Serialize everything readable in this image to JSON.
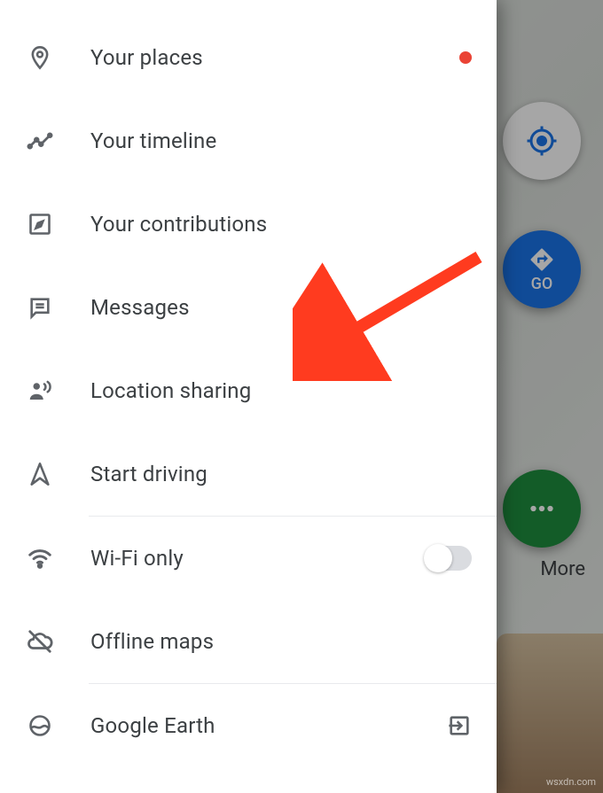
{
  "menu": {
    "items": [
      {
        "id": "your-places",
        "label": "Your places",
        "has_badge": true
      },
      {
        "id": "your-timeline",
        "label": "Your timeline"
      },
      {
        "id": "your-contributions",
        "label": "Your contributions"
      },
      {
        "id": "messages",
        "label": "Messages"
      },
      {
        "id": "location-sharing",
        "label": "Location sharing"
      },
      {
        "id": "start-driving",
        "label": "Start driving"
      },
      {
        "id": "wifi-only",
        "label": "Wi-Fi only",
        "toggle": false
      },
      {
        "id": "offline-maps",
        "label": "Offline maps"
      },
      {
        "id": "google-earth",
        "label": "Google Earth",
        "has_exit_icon": true
      }
    ]
  },
  "map": {
    "go_label": "GO",
    "more_label": "More"
  },
  "annotation": {
    "target": "location-sharing"
  },
  "watermark": "wsxdn.com"
}
